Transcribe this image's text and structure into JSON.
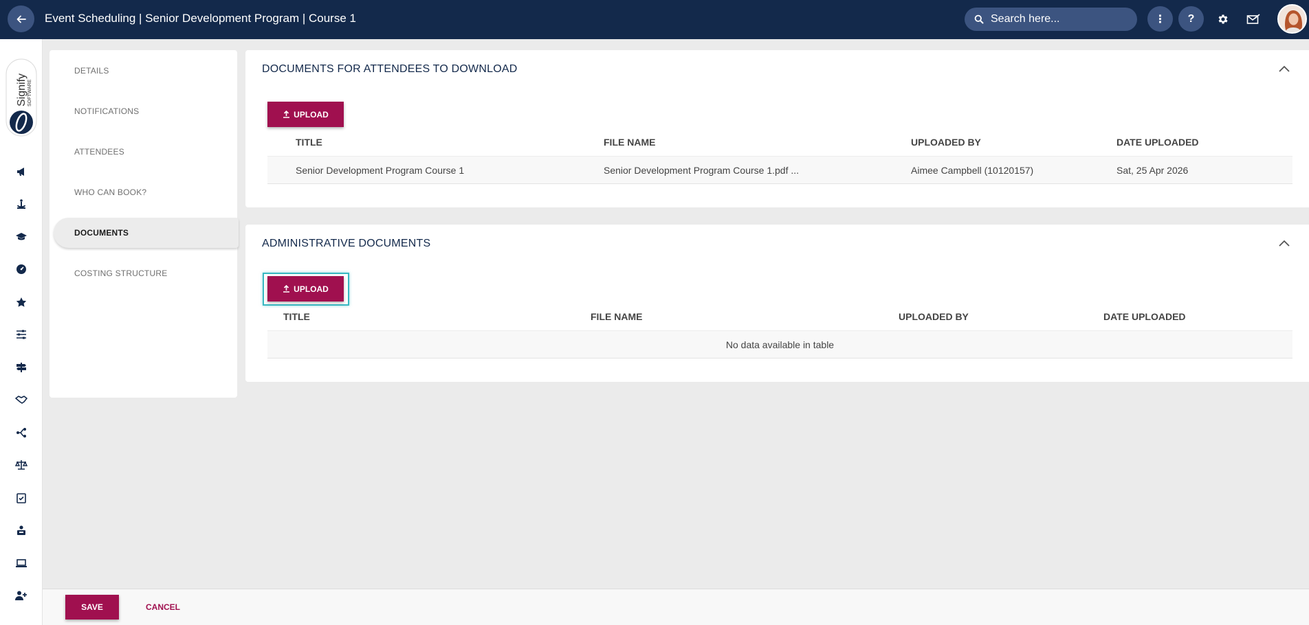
{
  "header": {
    "title": "Event Scheduling | Senior Development Program | Course 1",
    "search_placeholder": "Search here...",
    "more_label": "⋮",
    "help_label": "?"
  },
  "brand": {
    "logo_text": "Signify",
    "logo_subtext": "SOFTWARE",
    "accent": "#a0104f",
    "navy": "#13294b"
  },
  "rail_icons": [
    "megaphone-icon",
    "anchor-icon",
    "graduation-cap-icon",
    "gauge-icon",
    "star-icon",
    "sliders-icon",
    "signpost-icon",
    "handshake-icon",
    "branch-icon",
    "scales-icon",
    "checklist-icon",
    "user-badge-icon",
    "laptop-icon",
    "add-user-icon"
  ],
  "sidebar": {
    "items": [
      {
        "label": "DETAILS"
      },
      {
        "label": "NOTIFICATIONS"
      },
      {
        "label": "ATTENDEES"
      },
      {
        "label": "WHO CAN BOOK?"
      },
      {
        "label": "DOCUMENTS"
      },
      {
        "label": "COSTING STRUCTURE"
      }
    ],
    "active": "DOCUMENTS"
  },
  "attendee_docs": {
    "title": "DOCUMENTS FOR ATTENDEES TO DOWNLOAD",
    "upload_label": "UPLOAD",
    "columns": [
      "TITLE",
      "FILE NAME",
      "UPLOADED BY",
      "DATE UPLOADED"
    ],
    "rows": [
      [
        "Senior Development Program Course 1",
        "Senior Development Program Course 1.pdf ...",
        "Aimee Campbell (10120157)",
        "Sat, 25 Apr 2026"
      ]
    ]
  },
  "admin_docs": {
    "title": "ADMINISTRATIVE DOCUMENTS",
    "upload_label": "UPLOAD",
    "columns": [
      "TITLE",
      "FILE NAME",
      "UPLOADED BY",
      "DATE UPLOADED"
    ],
    "empty_message": "No data available in table"
  },
  "footer": {
    "save_label": "SAVE",
    "cancel_label": "CANCEL"
  }
}
